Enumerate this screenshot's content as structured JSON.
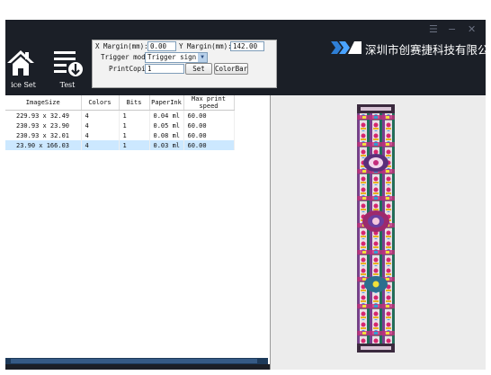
{
  "window": {
    "menu_glyph": "☰",
    "minimize_glyph": "−",
    "close_glyph": "✕"
  },
  "logo": {
    "company_name": "深圳市创赛捷科技有限公司"
  },
  "toolbar": {
    "device_set_label": "ice Set",
    "test_label": "Test"
  },
  "settings": {
    "x_margin_label": "X Margin(mm):",
    "x_margin_value": "0.00",
    "y_margin_label": "Y Margin(mm):",
    "y_margin_value": "142.00",
    "trigger_mode_label": "Trigger mode",
    "trigger_mode_value": "Trigger sign",
    "print_copies_label": "PrintCopies",
    "print_copies_value": "1",
    "set_label": "Set",
    "colorbar_label": "ColorBar"
  },
  "table": {
    "columns": [
      "ImageSize",
      "Colors",
      "Bits",
      "PaperInk",
      "Max print speed"
    ],
    "rows": [
      {
        "size": "229.93 x 32.49",
        "colors": "4",
        "bits": "1",
        "ink": "0.04 ml",
        "speed": "60.00"
      },
      {
        "size": "230.93 x 23.90",
        "colors": "4",
        "bits": "1",
        "ink": "0.05 ml",
        "speed": "60.00"
      },
      {
        "size": "230.93 x 32.01",
        "colors": "4",
        "bits": "1",
        "ink": "0.08 ml",
        "speed": "60.00"
      },
      {
        "size": "23.90 x 166.03",
        "colors": "4",
        "bits": "1",
        "ink": "0.03 ml",
        "speed": "60.00"
      }
    ],
    "selected_row": 3
  },
  "colors": {
    "app_bg": "#1b1f27",
    "selected_row_bg": "#cce8ff",
    "preview_bg": "#ececec"
  }
}
